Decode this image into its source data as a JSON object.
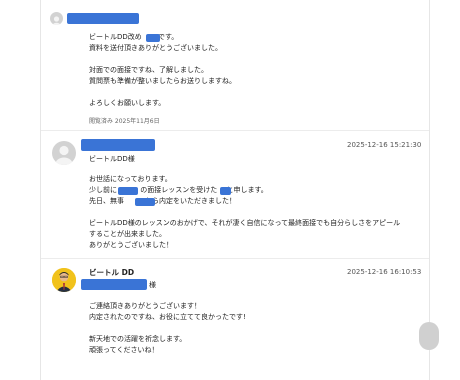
{
  "messages": [
    {
      "lines": [
        "ビートルDD改め　　 です。",
        "資料を送付頂きありがとうございました。",
        "",
        "対面での面接ですね、了解しました。",
        "質問票も準備が整いましたらお送りしますね。",
        "",
        "よろしくお願いします。"
      ],
      "read_status": "閲覧済み 2025年11月6日"
    },
    {
      "timestamp": "2025-12-16 15:21:30",
      "addressee": "ビートルDD様",
      "lines": [
        "お世話になっております。",
        "少し前に　　　 の面接レッスンを受けた　 と申します。",
        "先日、無事　　　から内定をいただきました！",
        "",
        "ビートルDD様のレッスンのおかげで、それが凄く自信になって最終面接でも自分らしさをアピール",
        "することが出来ました。",
        "ありがとうございました！"
      ]
    },
    {
      "sender": "ビートル DD",
      "timestamp": "2025-12-16 16:10:53",
      "honorific": "様",
      "lines": [
        "ご連絡頂きありがとうございます！",
        "内定されたのですね、お役に立てて良かったです!",
        "",
        "新天地での活躍を祈念します。",
        "頑張ってくださいね！"
      ]
    }
  ],
  "colors": {
    "redaction": "#3a74d6",
    "divider": "#ececec"
  },
  "icons": [
    "default-avatar-icon",
    "user-photo-avatar"
  ]
}
